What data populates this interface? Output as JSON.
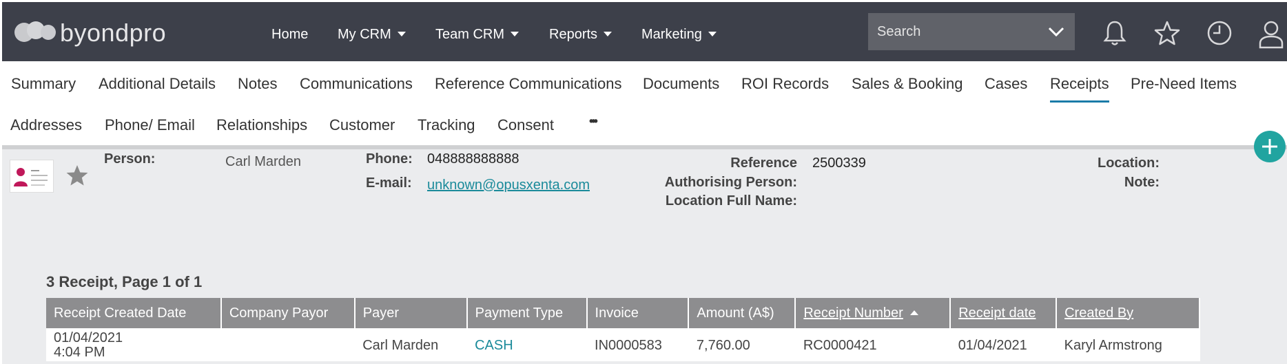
{
  "app": {
    "logo_text": "byondpro"
  },
  "nav": {
    "items": [
      {
        "label": "Home",
        "has_caret": false
      },
      {
        "label": "My CRM",
        "has_caret": true
      },
      {
        "label": "Team CRM",
        "has_caret": true
      },
      {
        "label": "Reports",
        "has_caret": true
      },
      {
        "label": "Marketing",
        "has_caret": true
      }
    ]
  },
  "search": {
    "placeholder": "Search",
    "icon": "chevron-down-icon"
  },
  "top_icons": [
    "bell-icon",
    "star-icon",
    "clock-icon",
    "user-icon"
  ],
  "tabs_row1": [
    "Summary",
    "Additional Details",
    "Notes",
    "Communications",
    "Reference Communications",
    "Documents",
    "ROI Records",
    "Sales & Booking",
    "Cases",
    "Receipts",
    "Pre-Need Items"
  ],
  "tabs_row2": [
    "Addresses",
    "Phone/ Email",
    "Relationships",
    "Customer",
    "Tracking",
    "Consent",
    "•••"
  ],
  "active_tab": "Receipts",
  "colors": {
    "topbar": "#3d404a",
    "accent": "#1a7ba8",
    "fab": "#21a4a0",
    "link": "#1a8a9a",
    "header": "#8d8d8f"
  },
  "record": {
    "person_label": "Person:",
    "person_value": "Carl Marden",
    "phone_label": "Phone:",
    "phone_value": "048888888888",
    "email_label": "E-mail:",
    "email_value": "unknown@opusxenta.com",
    "reference_label": "Reference",
    "reference_value": "2500339",
    "authorising_label": "Authorising Person:",
    "location_full_label": "Location Full Name:",
    "location_label": "Location:",
    "note_label": "Note:"
  },
  "receipts": {
    "heading": "3 Receipt, Page 1 of 1",
    "columns": [
      "Receipt Created Date",
      "Company Payor",
      "Payer",
      "Payment Type",
      "Invoice",
      "Amount (A$)",
      "Receipt Number",
      "Receipt date",
      "Created By"
    ],
    "rows": [
      {
        "created_date": "01/04/2021",
        "created_time": "4:04 PM",
        "company_payor": "",
        "payer": "Carl Marden",
        "payment_type": "CASH",
        "invoice": "IN0000583",
        "amount": "7,760.00",
        "receipt_number": "RC0000421",
        "receipt_date": "01/04/2021",
        "created_by": "Karyl Armstrong"
      }
    ]
  }
}
